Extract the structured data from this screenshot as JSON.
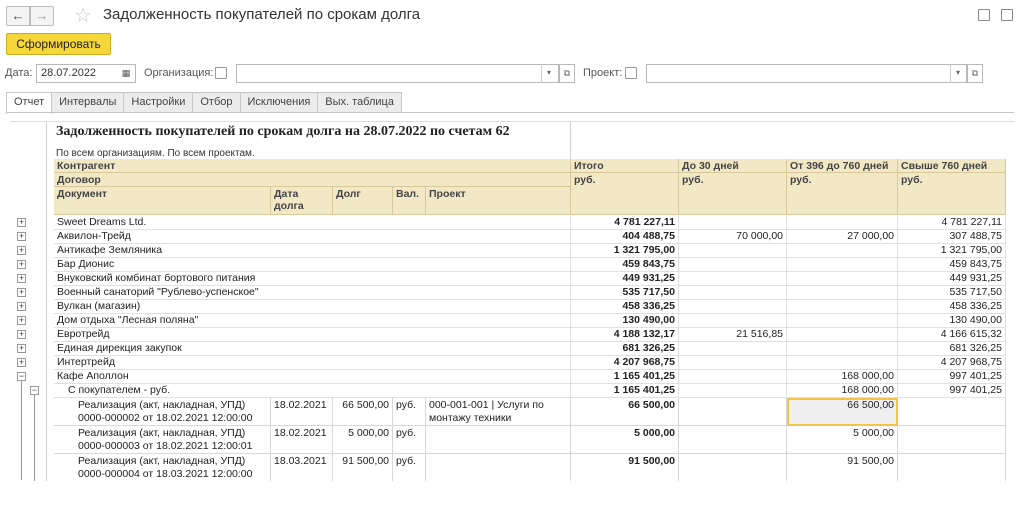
{
  "titlebar": {
    "back": "←",
    "forward": "→",
    "star": "☆",
    "title": "Задолженность покупателей по срокам долга"
  },
  "toolbar": {
    "run_label": "Сформировать"
  },
  "filters": {
    "date_label": "Дата:",
    "date_value": "28.07.2022",
    "org_label": "Организация:",
    "org_value": "",
    "project_label": "Проект:",
    "project_value": ""
  },
  "tabs": [
    "Отчет",
    "Интервалы",
    "Настройки",
    "Отбор",
    "Исключения",
    "Вых. таблица"
  ],
  "report": {
    "title": "Задолженность покупателей по срокам долга на 28.07.2022 по счетам 62",
    "subtitle": "По всем организациям. По всем проектам.",
    "headers": {
      "counterparty": "Контрагент",
      "contract": "Договор",
      "document": "Документ",
      "debt_date": "Дата долга",
      "debt": "Долг",
      "currency": "Вал.",
      "project": "Проект",
      "total": "Итого",
      "to30": "До 30 дней",
      "d396_760": "От 396 до 760 дней",
      "over760": "Свыше 760 дней",
      "unit": "руб."
    },
    "rows": [
      {
        "name": "Sweet Dreams Ltd.",
        "total": "4 781 227,11",
        "to30": "",
        "mid": "",
        "over": "4 781 227,11"
      },
      {
        "name": "Аквилон-Трейд",
        "total": "404 488,75",
        "to30": "70 000,00",
        "mid": "27 000,00",
        "over": "307 488,75"
      },
      {
        "name": "Антикафе Земляника",
        "total": "1 321 795,00",
        "to30": "",
        "mid": "",
        "over": "1 321 795,00"
      },
      {
        "name": "Бар Дионис",
        "total": "459 843,75",
        "to30": "",
        "mid": "",
        "over": "459 843,75"
      },
      {
        "name": "Внуковский комбинат бортового питания",
        "total": "449 931,25",
        "to30": "",
        "mid": "",
        "over": "449 931,25"
      },
      {
        "name": "Военный санаторий \"Рублево-успенское\"",
        "total": "535 717,50",
        "to30": "",
        "mid": "",
        "over": "535 717,50"
      },
      {
        "name": "Вулкан (магазин)",
        "total": "458 336,25",
        "to30": "",
        "mid": "",
        "over": "458 336,25"
      },
      {
        "name": "Дом отдыха \"Лесная поляна\"",
        "total": "130 490,00",
        "to30": "",
        "mid": "",
        "over": "130 490,00"
      },
      {
        "name": "Евротрейд",
        "total": "4 188 132,17",
        "to30": "21 516,85",
        "mid": "",
        "over": "4 166 615,32"
      },
      {
        "name": "Единая дирекция закупок",
        "total": "681 326,25",
        "to30": "",
        "mid": "",
        "over": "681 326,25"
      },
      {
        "name": "Интертрейд",
        "total": "4 207 968,75",
        "to30": "",
        "mid": "",
        "over": "4 207 968,75"
      },
      {
        "name": "Кафе Аполлон",
        "total": "1 165 401,25",
        "to30": "",
        "mid": "168 000,00",
        "over": "997 401,25"
      }
    ],
    "contract_row": {
      "name": "С покупателем - руб.",
      "total": "1 165 401,25",
      "to30": "",
      "mid": "168 000,00",
      "over": "997 401,25"
    },
    "docs": [
      {
        "line1": "Реализация (акт, накладная, УПД)",
        "line2": "0000-000002 от 18.02.2021 12:00:00",
        "date": "18.02.2021",
        "debt": "66 500,00",
        "cur": "руб.",
        "proj1": "000-001-001 | Услуги по",
        "proj2": "монтажу техники",
        "total": "66 500,00",
        "mid": "66 500,00"
      },
      {
        "line1": "Реализация (акт, накладная, УПД)",
        "line2": "0000-000003 от 18.02.2021 12:00:01",
        "date": "18.02.2021",
        "debt": "5 000,00",
        "cur": "руб.",
        "proj1": "",
        "proj2": "",
        "total": "5 000,00",
        "mid": "5 000,00"
      },
      {
        "line1": "Реализация (акт, накладная, УПД)",
        "line2": "0000-000004 от 18.03.2021 12:00:00",
        "date": "18.03.2021",
        "debt": "91 500,00",
        "cur": "руб.",
        "proj1": "",
        "proj2": "",
        "total": "91 500,00",
        "mid": "91 500,00"
      }
    ]
  }
}
